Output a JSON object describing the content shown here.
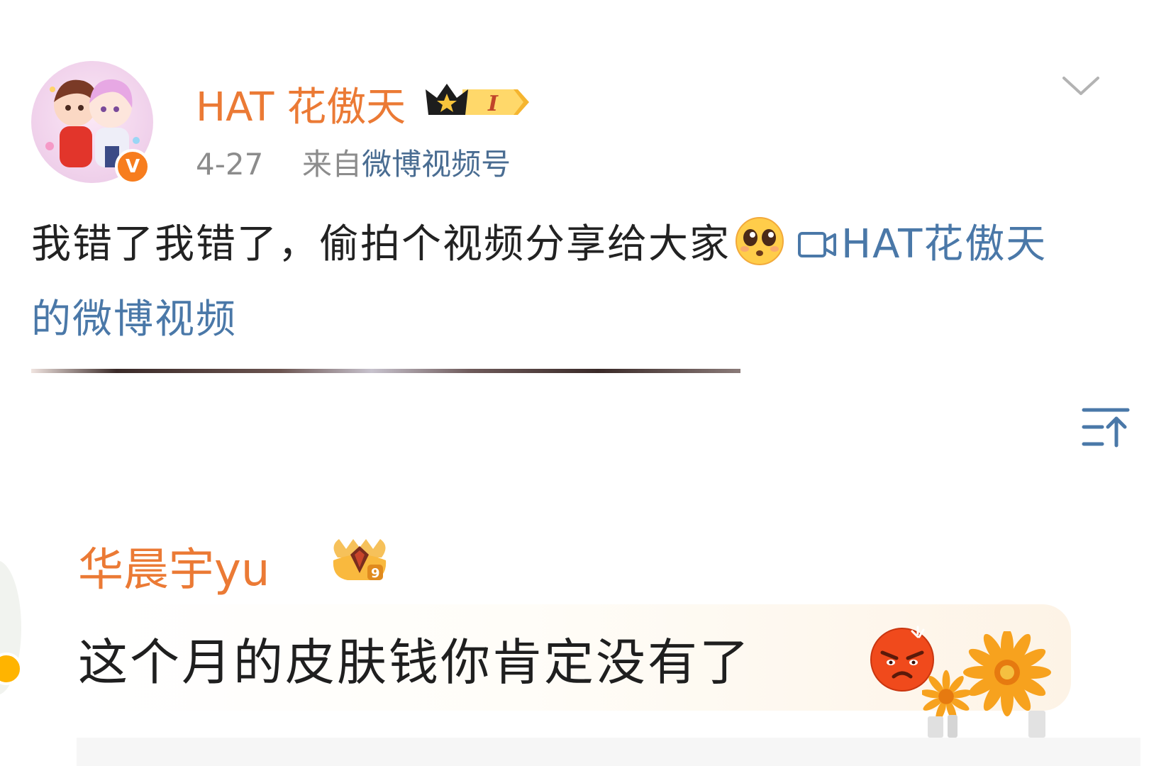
{
  "post": {
    "author": "HAT 花傲天",
    "level_badge": "I",
    "date": "4-27",
    "source_prefix": "来自",
    "source_name": "微博视频号",
    "text": "我错了我错了，偷拍个视频分享给大家",
    "video_link": "HAT花傲天的微博视频",
    "avatar_badge": "V"
  },
  "comment": {
    "author": "华晨宇yu",
    "fan_level": "9",
    "text": "这个月的皮肤钱你肯定没有了"
  },
  "icons": {
    "chevron": "chevron-down-icon",
    "collapse": "collapse-up-icon",
    "video": "video-camera-icon",
    "emoji_post": "pleading-face-emoji",
    "emoji_comment": "angry-face-emoji",
    "sticker": "sunflower-sticker"
  },
  "colors": {
    "username": "#eb7a35",
    "link": "#4a78a8",
    "meta": "#8c8c8c",
    "verified": "#f77d1e"
  }
}
